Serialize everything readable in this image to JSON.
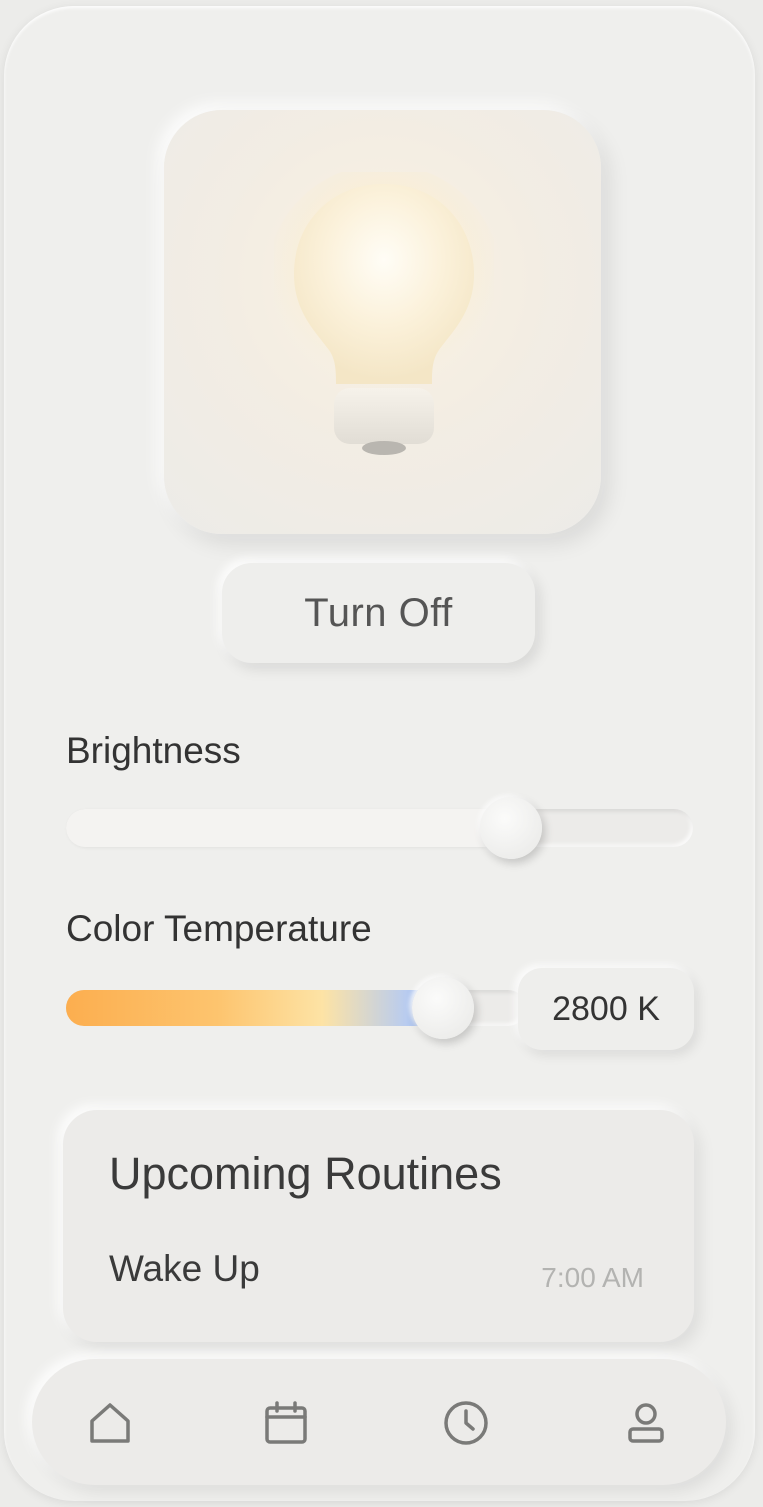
{
  "control": {
    "toggle_label": "Turn Off",
    "bulb_icon": "lightbulb-icon"
  },
  "brightness": {
    "label": "Brightness",
    "level": 0.71
  },
  "color_temperature": {
    "label": "Color Temperature",
    "value": "2800 K",
    "level": 0.82,
    "gradient_colors": [
      "#fcae4f",
      "#fdc46e",
      "#fde3a5",
      "#b9ccef",
      "#8fb1f2"
    ]
  },
  "routines": {
    "title": "Upcoming Routines",
    "items": [
      {
        "name": "Wake Up",
        "time": "7:00 AM"
      }
    ]
  },
  "nav": {
    "items": [
      {
        "icon": "home-icon"
      },
      {
        "icon": "calendar-icon"
      },
      {
        "icon": "clock-icon"
      },
      {
        "icon": "profile-icon"
      }
    ]
  },
  "colors": {
    "background": "#ececea",
    "text": "#333333",
    "muted_text": "#b3b3b1",
    "icon": "#7a7a78"
  }
}
